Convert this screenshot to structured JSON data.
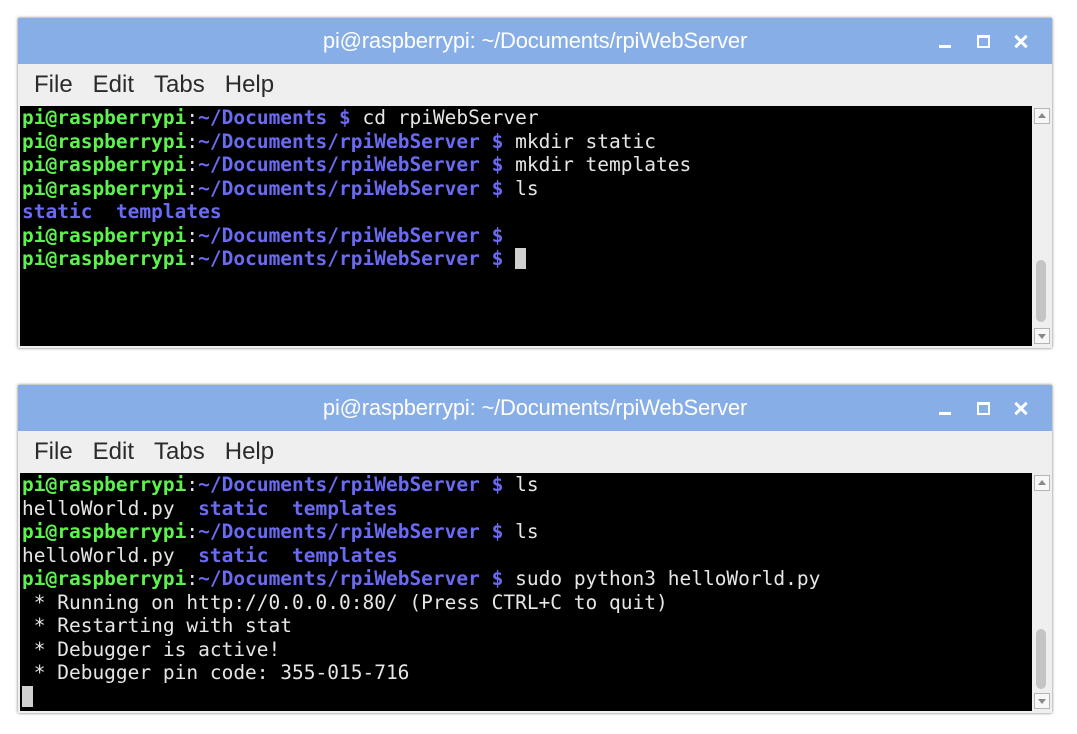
{
  "windows": [
    {
      "title": "pi@raspberrypi: ~/Documents/rpiWebServer",
      "menu": [
        "File",
        "Edit",
        "Tabs",
        "Help"
      ],
      "lines": [
        {
          "type": "prompt",
          "user_host": "pi@raspberrypi",
          "sep": ":",
          "path": "~/Documents $",
          "cmd": " cd rpiWebServer"
        },
        {
          "type": "prompt",
          "user_host": "pi@raspberrypi",
          "sep": ":",
          "path": "~/Documents/rpiWebServer $",
          "cmd": " mkdir static"
        },
        {
          "type": "prompt",
          "user_host": "pi@raspberrypi",
          "sep": ":",
          "path": "~/Documents/rpiWebServer $",
          "cmd": " mkdir templates"
        },
        {
          "type": "prompt",
          "user_host": "pi@raspberrypi",
          "sep": ":",
          "path": "~/Documents/rpiWebServer $",
          "cmd": " ls"
        },
        {
          "type": "listing",
          "items": [
            {
              "text": "static",
              "kind": "dir"
            },
            {
              "text": "templates",
              "kind": "dir"
            }
          ]
        },
        {
          "type": "prompt",
          "user_host": "pi@raspberrypi",
          "sep": ":",
          "path": "~/Documents/rpiWebServer $",
          "cmd": ""
        },
        {
          "type": "prompt",
          "user_host": "pi@raspberrypi",
          "sep": ":",
          "path": "~/Documents/rpiWebServer $",
          "cmd": " ",
          "cursor": true
        }
      ]
    },
    {
      "title": "pi@raspberrypi: ~/Documents/rpiWebServer",
      "menu": [
        "File",
        "Edit",
        "Tabs",
        "Help"
      ],
      "lines": [
        {
          "type": "prompt",
          "user_host": "pi@raspberrypi",
          "sep": ":",
          "path": "~/Documents/rpiWebServer $",
          "cmd": " ls"
        },
        {
          "type": "listing",
          "items": [
            {
              "text": "helloWorld.py",
              "kind": "file"
            },
            {
              "text": "static",
              "kind": "dir"
            },
            {
              "text": "templates",
              "kind": "dir"
            }
          ]
        },
        {
          "type": "prompt",
          "user_host": "pi@raspberrypi",
          "sep": ":",
          "path": "~/Documents/rpiWebServer $",
          "cmd": " ls"
        },
        {
          "type": "listing",
          "items": [
            {
              "text": "helloWorld.py",
              "kind": "file"
            },
            {
              "text": "static",
              "kind": "dir"
            },
            {
              "text": "templates",
              "kind": "dir"
            }
          ]
        },
        {
          "type": "prompt",
          "user_host": "pi@raspberrypi",
          "sep": ":",
          "path": "~/Documents/rpiWebServer $",
          "cmd": " sudo python3 helloWorld.py"
        },
        {
          "type": "output",
          "text": " * Running on http://0.0.0.0:80/ (Press CTRL+C to quit)"
        },
        {
          "type": "output",
          "text": " * Restarting with stat"
        },
        {
          "type": "output",
          "text": " * Debugger is active!"
        },
        {
          "type": "output",
          "text": " * Debugger pin code: 355-015-716"
        },
        {
          "type": "cursor"
        }
      ]
    }
  ],
  "colors": {
    "titlebar": "#87aee6",
    "terminal_bg": "#000000",
    "prompt_user": "#5ef24e",
    "prompt_path": "#6a6af2",
    "text": "#e6e6e6"
  }
}
